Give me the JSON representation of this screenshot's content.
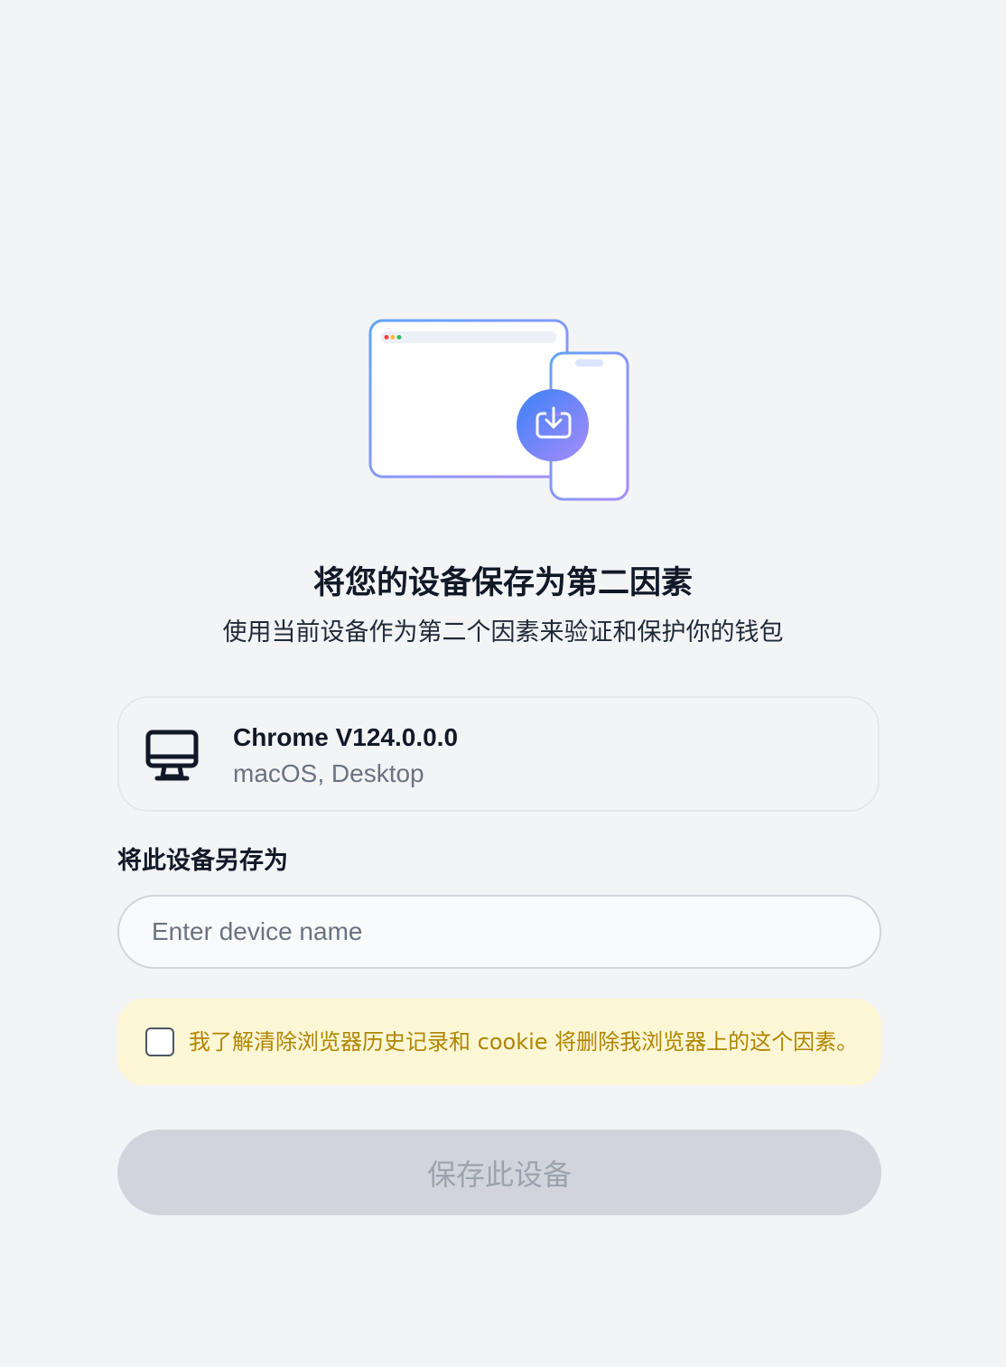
{
  "header": {
    "title": "将您的设备保存为第二因素",
    "subtitle": "使用当前设备作为第二个因素来验证和保护你的钱包"
  },
  "device": {
    "name": "Chrome V124.0.0.0",
    "meta": "macOS, Desktop",
    "icon": "monitor-icon"
  },
  "form": {
    "label": "将此设备另存为",
    "input_placeholder": "Enter device name",
    "input_value": ""
  },
  "notice": {
    "text": "我了解清除浏览器历史记录和 cookie 将删除我浏览器上的这个因素。",
    "checked": false
  },
  "actions": {
    "save_label": "保存此设备"
  },
  "colors": {
    "background": "#f3f4f6",
    "notice_bg": "#fef7d6",
    "notice_text": "#b08500",
    "button_disabled_bg": "#d1d5db",
    "button_disabled_text": "#9ca3af",
    "gradient_start": "#60a5fa",
    "gradient_end": "#a78bfa"
  }
}
